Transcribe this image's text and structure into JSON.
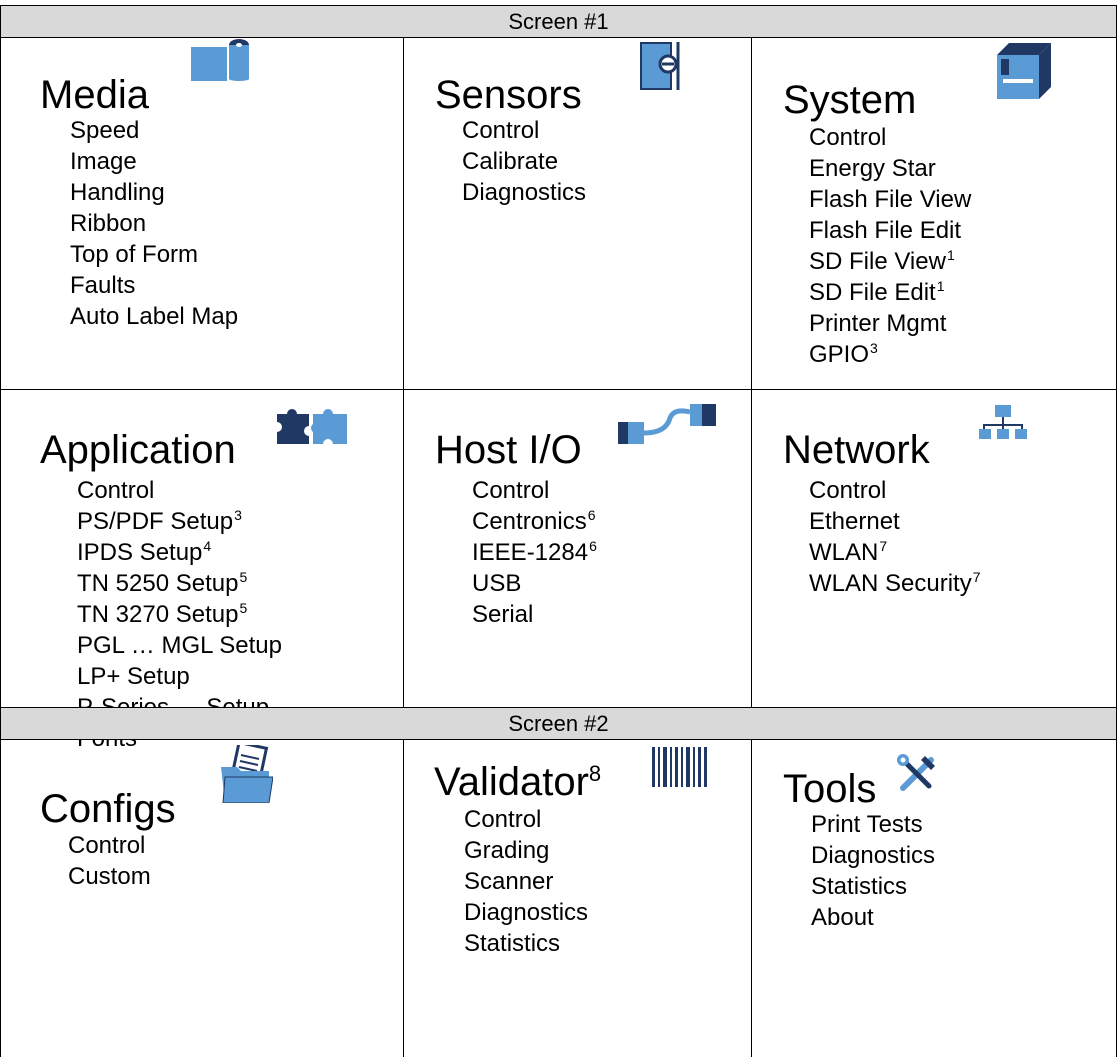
{
  "screen1": {
    "label": "Screen #1",
    "rows": [
      [
        {
          "title": "Media",
          "title_sup": "",
          "icon": "media-roll-icon",
          "items": [
            {
              "text": "Speed",
              "sup": ""
            },
            {
              "text": "Image",
              "sup": ""
            },
            {
              "text": "Handling",
              "sup": ""
            },
            {
              "text": "Ribbon",
              "sup": ""
            },
            {
              "text": "Top of Form",
              "sup": ""
            },
            {
              "text": "Faults",
              "sup": ""
            },
            {
              "text": "Auto Label Map",
              "sup": ""
            }
          ]
        },
        {
          "title": "Sensors",
          "title_sup": "",
          "icon": "sensor-icon",
          "items": [
            {
              "text": "Control",
              "sup": ""
            },
            {
              "text": "Calibrate",
              "sup": ""
            },
            {
              "text": "Diagnostics",
              "sup": ""
            }
          ]
        },
        {
          "title": "System",
          "title_sup": "",
          "icon": "printer-icon",
          "items": [
            {
              "text": "Control",
              "sup": ""
            },
            {
              "text": "Energy Star",
              "sup": ""
            },
            {
              "text": "Flash File View",
              "sup": ""
            },
            {
              "text": "Flash File Edit",
              "sup": ""
            },
            {
              "text": "SD File View",
              "sup": "1"
            },
            {
              "text": "SD File Edit",
              "sup": "1"
            },
            {
              "text": "Printer Mgmt",
              "sup": ""
            },
            {
              "text": "GPIO",
              "sup": "3"
            }
          ]
        }
      ],
      [
        {
          "title": "Application",
          "title_sup": "",
          "icon": "puzzle-icon",
          "items": [
            {
              "text": "Control",
              "sup": ""
            },
            {
              "text": "PS/PDF Setup",
              "sup": "3"
            },
            {
              "text": "IPDS Setup",
              "sup": "4"
            },
            {
              "text": "TN 5250 Setup",
              "sup": "5"
            },
            {
              "text": "TN 3270 Setup",
              "sup": "5"
            },
            {
              "text": "PGL … MGL Setup",
              "sup": ""
            },
            {
              "text": "LP+ Setup",
              "sup": ""
            },
            {
              "text": "P-Series … Setup",
              "sup": ""
            },
            {
              "text": "Fonts",
              "sup": ""
            }
          ]
        },
        {
          "title": "Host I/O",
          "title_sup": "",
          "icon": "cable-icon",
          "items": [
            {
              "text": "Control",
              "sup": ""
            },
            {
              "text": "Centronics",
              "sup": "6"
            },
            {
              "text": "IEEE-1284",
              "sup": "6"
            },
            {
              "text": "USB",
              "sup": ""
            },
            {
              "text": "Serial",
              "sup": ""
            }
          ]
        },
        {
          "title": "Network",
          "title_sup": "",
          "icon": "network-icon",
          "items": [
            {
              "text": "Control",
              "sup": ""
            },
            {
              "text": "Ethernet",
              "sup": ""
            },
            {
              "text": "WLAN",
              "sup": "7"
            },
            {
              "text": "WLAN Security",
              "sup": "7"
            }
          ]
        }
      ]
    ]
  },
  "screen2": {
    "label": "Screen #2",
    "cells": [
      {
        "title": "Configs",
        "title_sup": "",
        "icon": "folder-icon",
        "items": [
          {
            "text": "Control",
            "sup": ""
          },
          {
            "text": "Custom",
            "sup": ""
          }
        ]
      },
      {
        "title": "Validator",
        "title_sup": "8",
        "icon": "barcode-icon",
        "items": [
          {
            "text": "Control",
            "sup": ""
          },
          {
            "text": "Grading",
            "sup": ""
          },
          {
            "text": "Scanner",
            "sup": ""
          },
          {
            "text": "Diagnostics",
            "sup": ""
          },
          {
            "text": "Statistics",
            "sup": ""
          }
        ]
      },
      {
        "title": "Tools",
        "title_sup": "",
        "icon": "tools-icon",
        "items": [
          {
            "text": "Print Tests",
            "sup": ""
          },
          {
            "text": "Diagnostics",
            "sup": ""
          },
          {
            "text": "Statistics",
            "sup": ""
          },
          {
            "text": "About",
            "sup": ""
          }
        ]
      }
    ]
  },
  "colors": {
    "icon_fill": "#5b9bd5",
    "icon_dark": "#1f3864",
    "band_bg": "#d9d9d9"
  }
}
